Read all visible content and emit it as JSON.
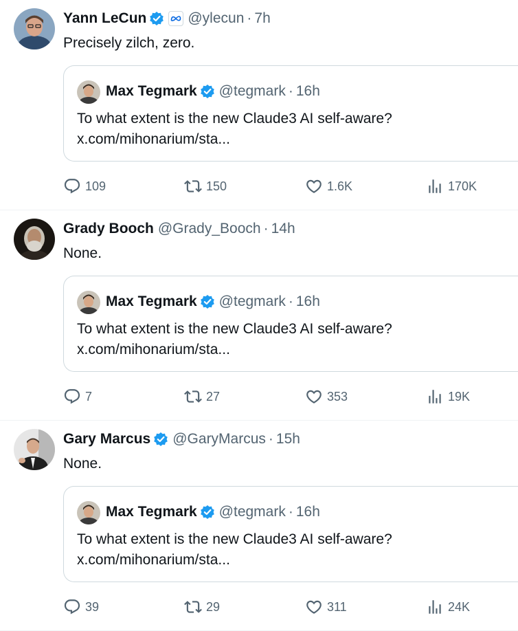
{
  "tweets": [
    {
      "author": {
        "name": "Yann LeCun",
        "handle": "@ylecun",
        "verified": true,
        "affiliation_icon": "meta-logo-icon"
      },
      "time": "7h",
      "text": "Precisely zilch, zero.",
      "quoted": {
        "author": {
          "name": "Max Tegmark",
          "handle": "@tegmark",
          "verified": true
        },
        "time": "16h",
        "line1": "To what extent is the new Claude3 AI self-aware?",
        "line2": "x.com/mihonarium/sta..."
      },
      "stats": {
        "replies": "109",
        "retweets": "150",
        "likes": "1.6K",
        "views": "170K"
      }
    },
    {
      "author": {
        "name": "Grady Booch",
        "handle": "@Grady_Booch",
        "verified": false
      },
      "time": "14h",
      "text": "None.",
      "quoted": {
        "author": {
          "name": "Max Tegmark",
          "handle": "@tegmark",
          "verified": true
        },
        "time": "16h",
        "line1": "To what extent is the new Claude3 AI self-aware?",
        "line2": "x.com/mihonarium/sta..."
      },
      "stats": {
        "replies": "7",
        "retweets": "27",
        "likes": "353",
        "views": "19K"
      }
    },
    {
      "author": {
        "name": "Gary Marcus",
        "handle": "@GaryMarcus",
        "verified": true
      },
      "time": "15h",
      "text": "None.",
      "quoted": {
        "author": {
          "name": "Max Tegmark",
          "handle": "@tegmark",
          "verified": true
        },
        "time": "16h",
        "line1": "To what extent is the new Claude3 AI self-aware?",
        "line2": "x.com/mihonarium/sta..."
      },
      "stats": {
        "replies": "39",
        "retweets": "29",
        "likes": "311",
        "views": "24K"
      }
    }
  ],
  "separator": "·",
  "colors": {
    "verified": "#1d9bf0",
    "secondary_text": "#536471",
    "border": "#cfd9de",
    "meta_blue": "#0668e1"
  }
}
